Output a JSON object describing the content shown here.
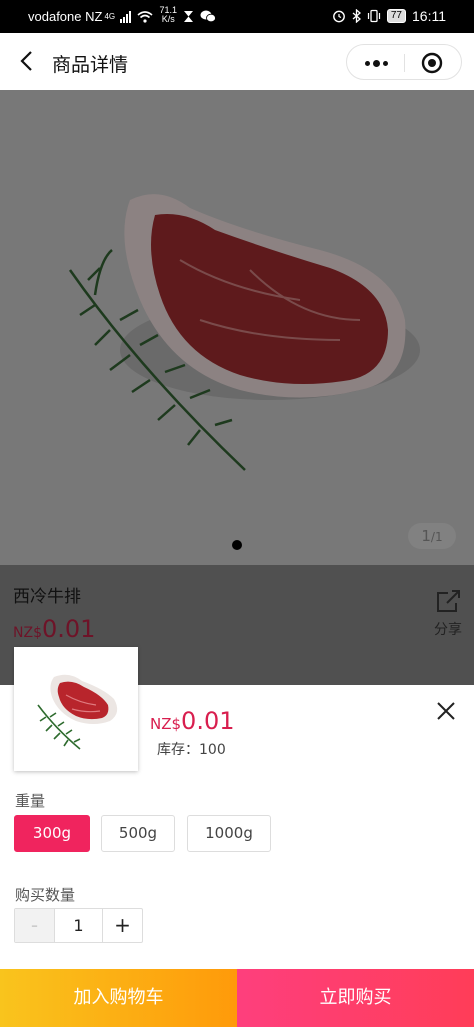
{
  "status_bar": {
    "carrier": "vodafone NZ",
    "network": "4G",
    "speed_value": "71.1",
    "speed_unit": "K/s",
    "battery": "77",
    "time": "16:11"
  },
  "nav": {
    "title": "商品详情"
  },
  "gallery": {
    "pager_current": "1",
    "pager_total": "/1",
    "image_icon": "steak-image"
  },
  "product": {
    "name": "西冷牛排",
    "currency": "NZ$",
    "price": "0.01",
    "share_label": "分享"
  },
  "sku_sheet": {
    "currency": "NZ$",
    "price": "0.01",
    "stock": "库存：100",
    "weight_label": "重量",
    "weights": [
      "300g",
      "500g",
      "1000g"
    ],
    "selected_weight": "300g",
    "qty_label": "购买数量",
    "qty": "1",
    "minus": "-",
    "plus": "+"
  },
  "actions": {
    "add_to_cart": "加入购物车",
    "buy_now": "立即购买"
  },
  "colors": {
    "accent": "#f0245e",
    "cart_button": "#ffb015",
    "buy_button": "#ff3d6a"
  }
}
